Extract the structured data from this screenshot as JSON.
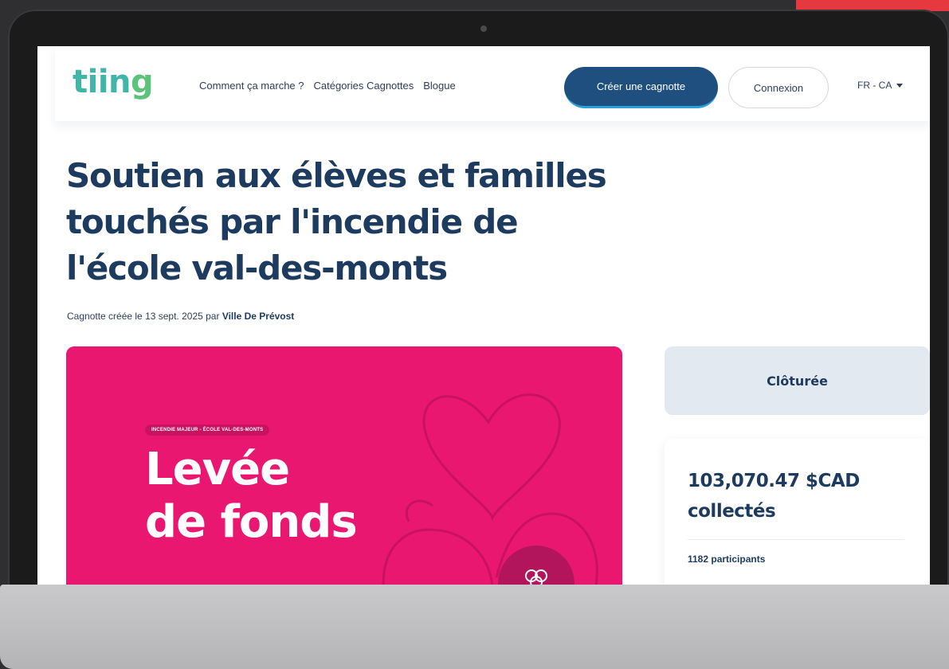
{
  "nav": {
    "logo_main": "tiin",
    "logo_accent": "g",
    "links": [
      "Comment ça marche ?",
      "Catégories Cagnottes",
      "Blogue"
    ],
    "create_button": "Créer une cagnotte",
    "login_button": "Connexion",
    "language": "FR - CA"
  },
  "campaign": {
    "title": "Soutien aux élèves et familles touchés par l'incendie de l'école val-des-monts",
    "meta_prefix": "Cagnotte créée le 13 sept. 2025 par",
    "author": "Ville De Prévost",
    "hero_tag": "INCENDIE MAJEUR - ÉCOLE VAL-DES-MONTS",
    "hero_line1": "Levée",
    "hero_line2": "de fonds"
  },
  "sidebar": {
    "status": "Clôturée",
    "amount": "103,070.47 $CAD",
    "amount_suffix": "collectés",
    "participants": "1182 participants"
  },
  "colors": {
    "brand_navy": "#1d3b5f",
    "logo_teal": "#3fb6a8",
    "logo_green": "#5cc47a",
    "hero_pink": "#ea1771",
    "accent_red": "#e5383f"
  }
}
